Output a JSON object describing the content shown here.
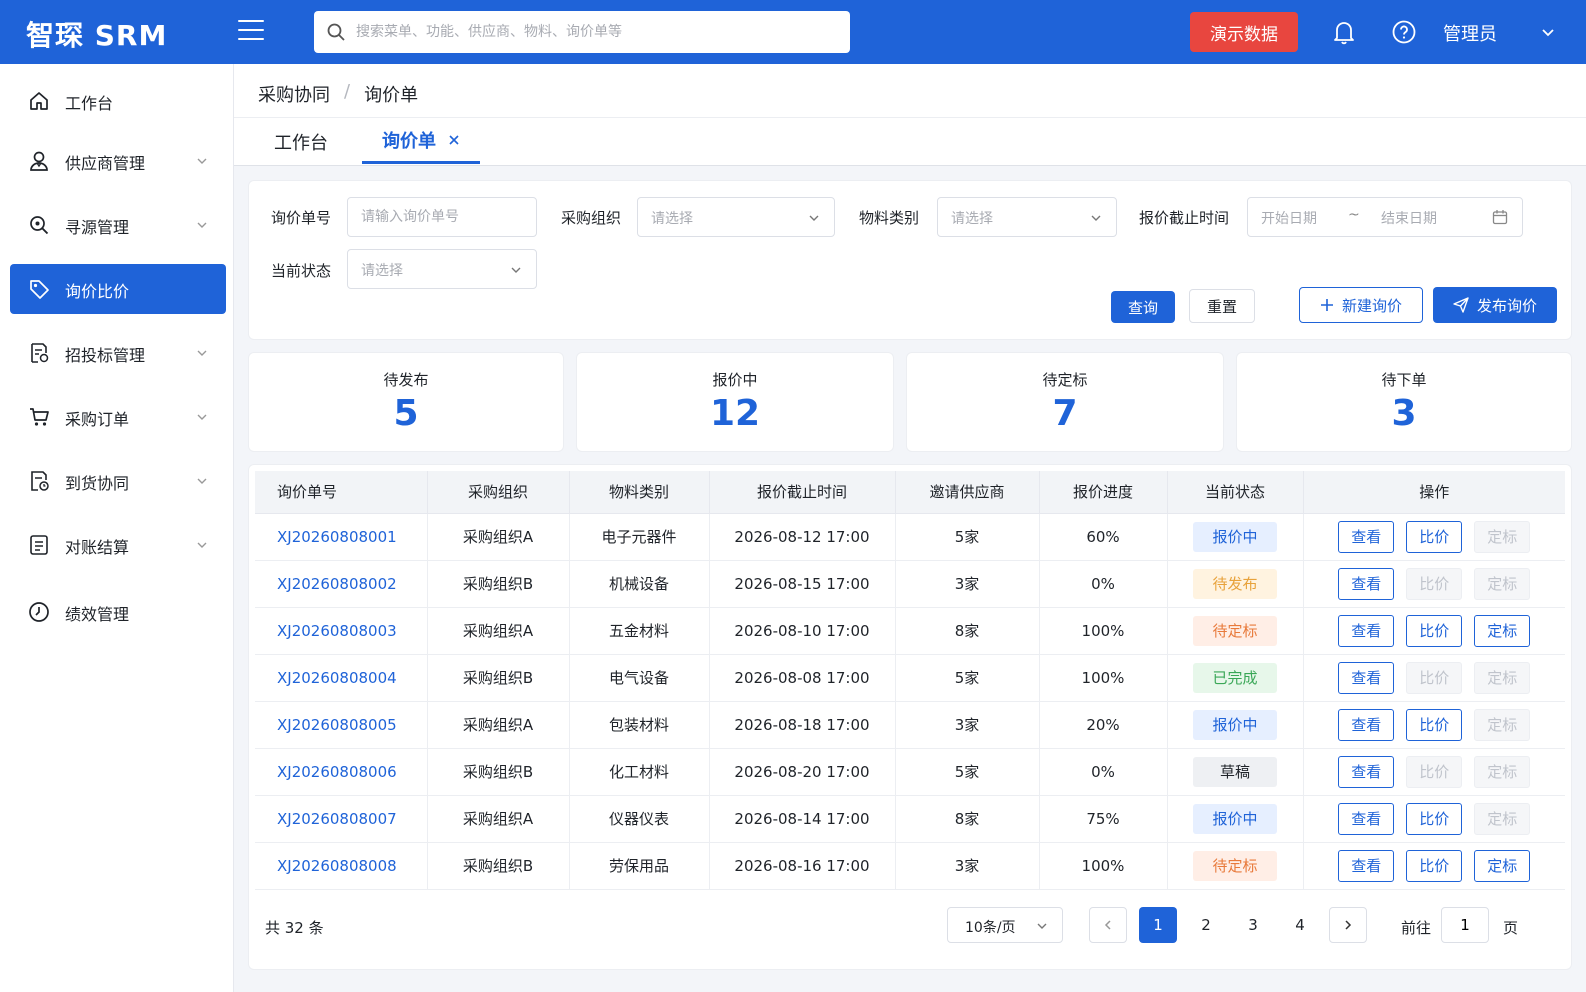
{
  "header": {
    "brand": "智琛 SRM",
    "search_placeholder": "搜索菜单、功能、供应商、物料、询价单等",
    "demo_label": "演示数据",
    "user": "管理员"
  },
  "sidebar": {
    "items": [
      {
        "label": "工作台"
      },
      {
        "label": "供应商管理"
      },
      {
        "label": "寻源管理"
      },
      {
        "label": "询价比价"
      },
      {
        "label": "招投标管理"
      },
      {
        "label": "采购订单"
      },
      {
        "label": "到货协同"
      },
      {
        "label": "对账结算"
      },
      {
        "label": "绩效管理"
      }
    ]
  },
  "breadcrumb": {
    "parent": "采购协同",
    "sep": "/",
    "current": "询价单"
  },
  "tabs": [
    {
      "label": "工作台"
    },
    {
      "label": "询价单"
    }
  ],
  "filters": {
    "inquiry_no_label": "询价单号",
    "inquiry_no_placeholder": "请输入询价单号",
    "org_label": "采购组织",
    "org_placeholder": "请选择",
    "category_label": "物料类别",
    "category_placeholder": "请选择",
    "deadline_label": "报价截止时间",
    "start_placeholder": "开始日期",
    "range_sep": "~",
    "end_placeholder": "结束日期",
    "status_label": "当前状态",
    "status_placeholder": "请选择",
    "query_label": "查询",
    "reset_label": "重置",
    "new_label": "新建询价",
    "publish_label": "发布询价"
  },
  "stats": [
    {
      "label": "待发布",
      "value": "5"
    },
    {
      "label": "报价中",
      "value": "12"
    },
    {
      "label": "待定标",
      "value": "7"
    },
    {
      "label": "待下单",
      "value": "3"
    }
  ],
  "table": {
    "columns": [
      "询价单号",
      "采购组织",
      "物料类别",
      "报价截止时间",
      "邀请供应商",
      "报价进度",
      "当前状态",
      "操作"
    ],
    "op_labels": {
      "view": "查看",
      "compare": "比价",
      "award": "定标"
    },
    "rows": [
      {
        "no": "XJ20260808001",
        "org": "采购组织A",
        "category": "电子元器件",
        "deadline": "2026-08-12  17:00",
        "suppliers": "5家",
        "progress": "60%",
        "status": "报价中",
        "status_class": "s-quoting",
        "compare": true,
        "award": false
      },
      {
        "no": "XJ20260808002",
        "org": "采购组织B",
        "category": "机械设备",
        "deadline": "2026-08-15  17:00",
        "suppliers": "3家",
        "progress": "0%",
        "status": "待发布",
        "status_class": "s-pending",
        "compare": false,
        "award": false
      },
      {
        "no": "XJ20260808003",
        "org": "采购组织A",
        "category": "五金材料",
        "deadline": "2026-08-10  17:00",
        "suppliers": "8家",
        "progress": "100%",
        "status": "待定标",
        "status_class": "s-award",
        "compare": true,
        "award": true
      },
      {
        "no": "XJ20260808004",
        "org": "采购组织B",
        "category": "电气设备",
        "deadline": "2026-08-08  17:00",
        "suppliers": "5家",
        "progress": "100%",
        "status": "已完成",
        "status_class": "s-done",
        "compare": false,
        "award": false
      },
      {
        "no": "XJ20260808005",
        "org": "采购组织A",
        "category": "包装材料",
        "deadline": "2026-08-18  17:00",
        "suppliers": "3家",
        "progress": "20%",
        "status": "报价中",
        "status_class": "s-quoting",
        "compare": true,
        "award": false
      },
      {
        "no": "XJ20260808006",
        "org": "采购组织B",
        "category": "化工材料",
        "deadline": "2026-08-20  17:00",
        "suppliers": "5家",
        "progress": "0%",
        "status": "草稿",
        "status_class": "s-draft",
        "compare": false,
        "award": false
      },
      {
        "no": "XJ20260808007",
        "org": "采购组织A",
        "category": "仪器仪表",
        "deadline": "2026-08-14  17:00",
        "suppliers": "8家",
        "progress": "75%",
        "status": "报价中",
        "status_class": "s-quoting",
        "compare": true,
        "award": false
      },
      {
        "no": "XJ20260808008",
        "org": "采购组织B",
        "category": "劳保用品",
        "deadline": "2026-08-16  17:00",
        "suppliers": "3家",
        "progress": "100%",
        "status": "待定标",
        "status_class": "s-award",
        "compare": true,
        "award": true
      }
    ]
  },
  "pagination": {
    "total_text": "共 32 条",
    "page_size": "10条/页",
    "pages": [
      "1",
      "2",
      "3",
      "4"
    ],
    "current_page": "1",
    "goto_label": "前往",
    "goto_value": "1",
    "goto_suffix": "页"
  },
  "colors": {
    "primary": "#1f63d8",
    "danger": "#e8463f",
    "success": "#3aa757",
    "warning": "#e8a23b"
  }
}
